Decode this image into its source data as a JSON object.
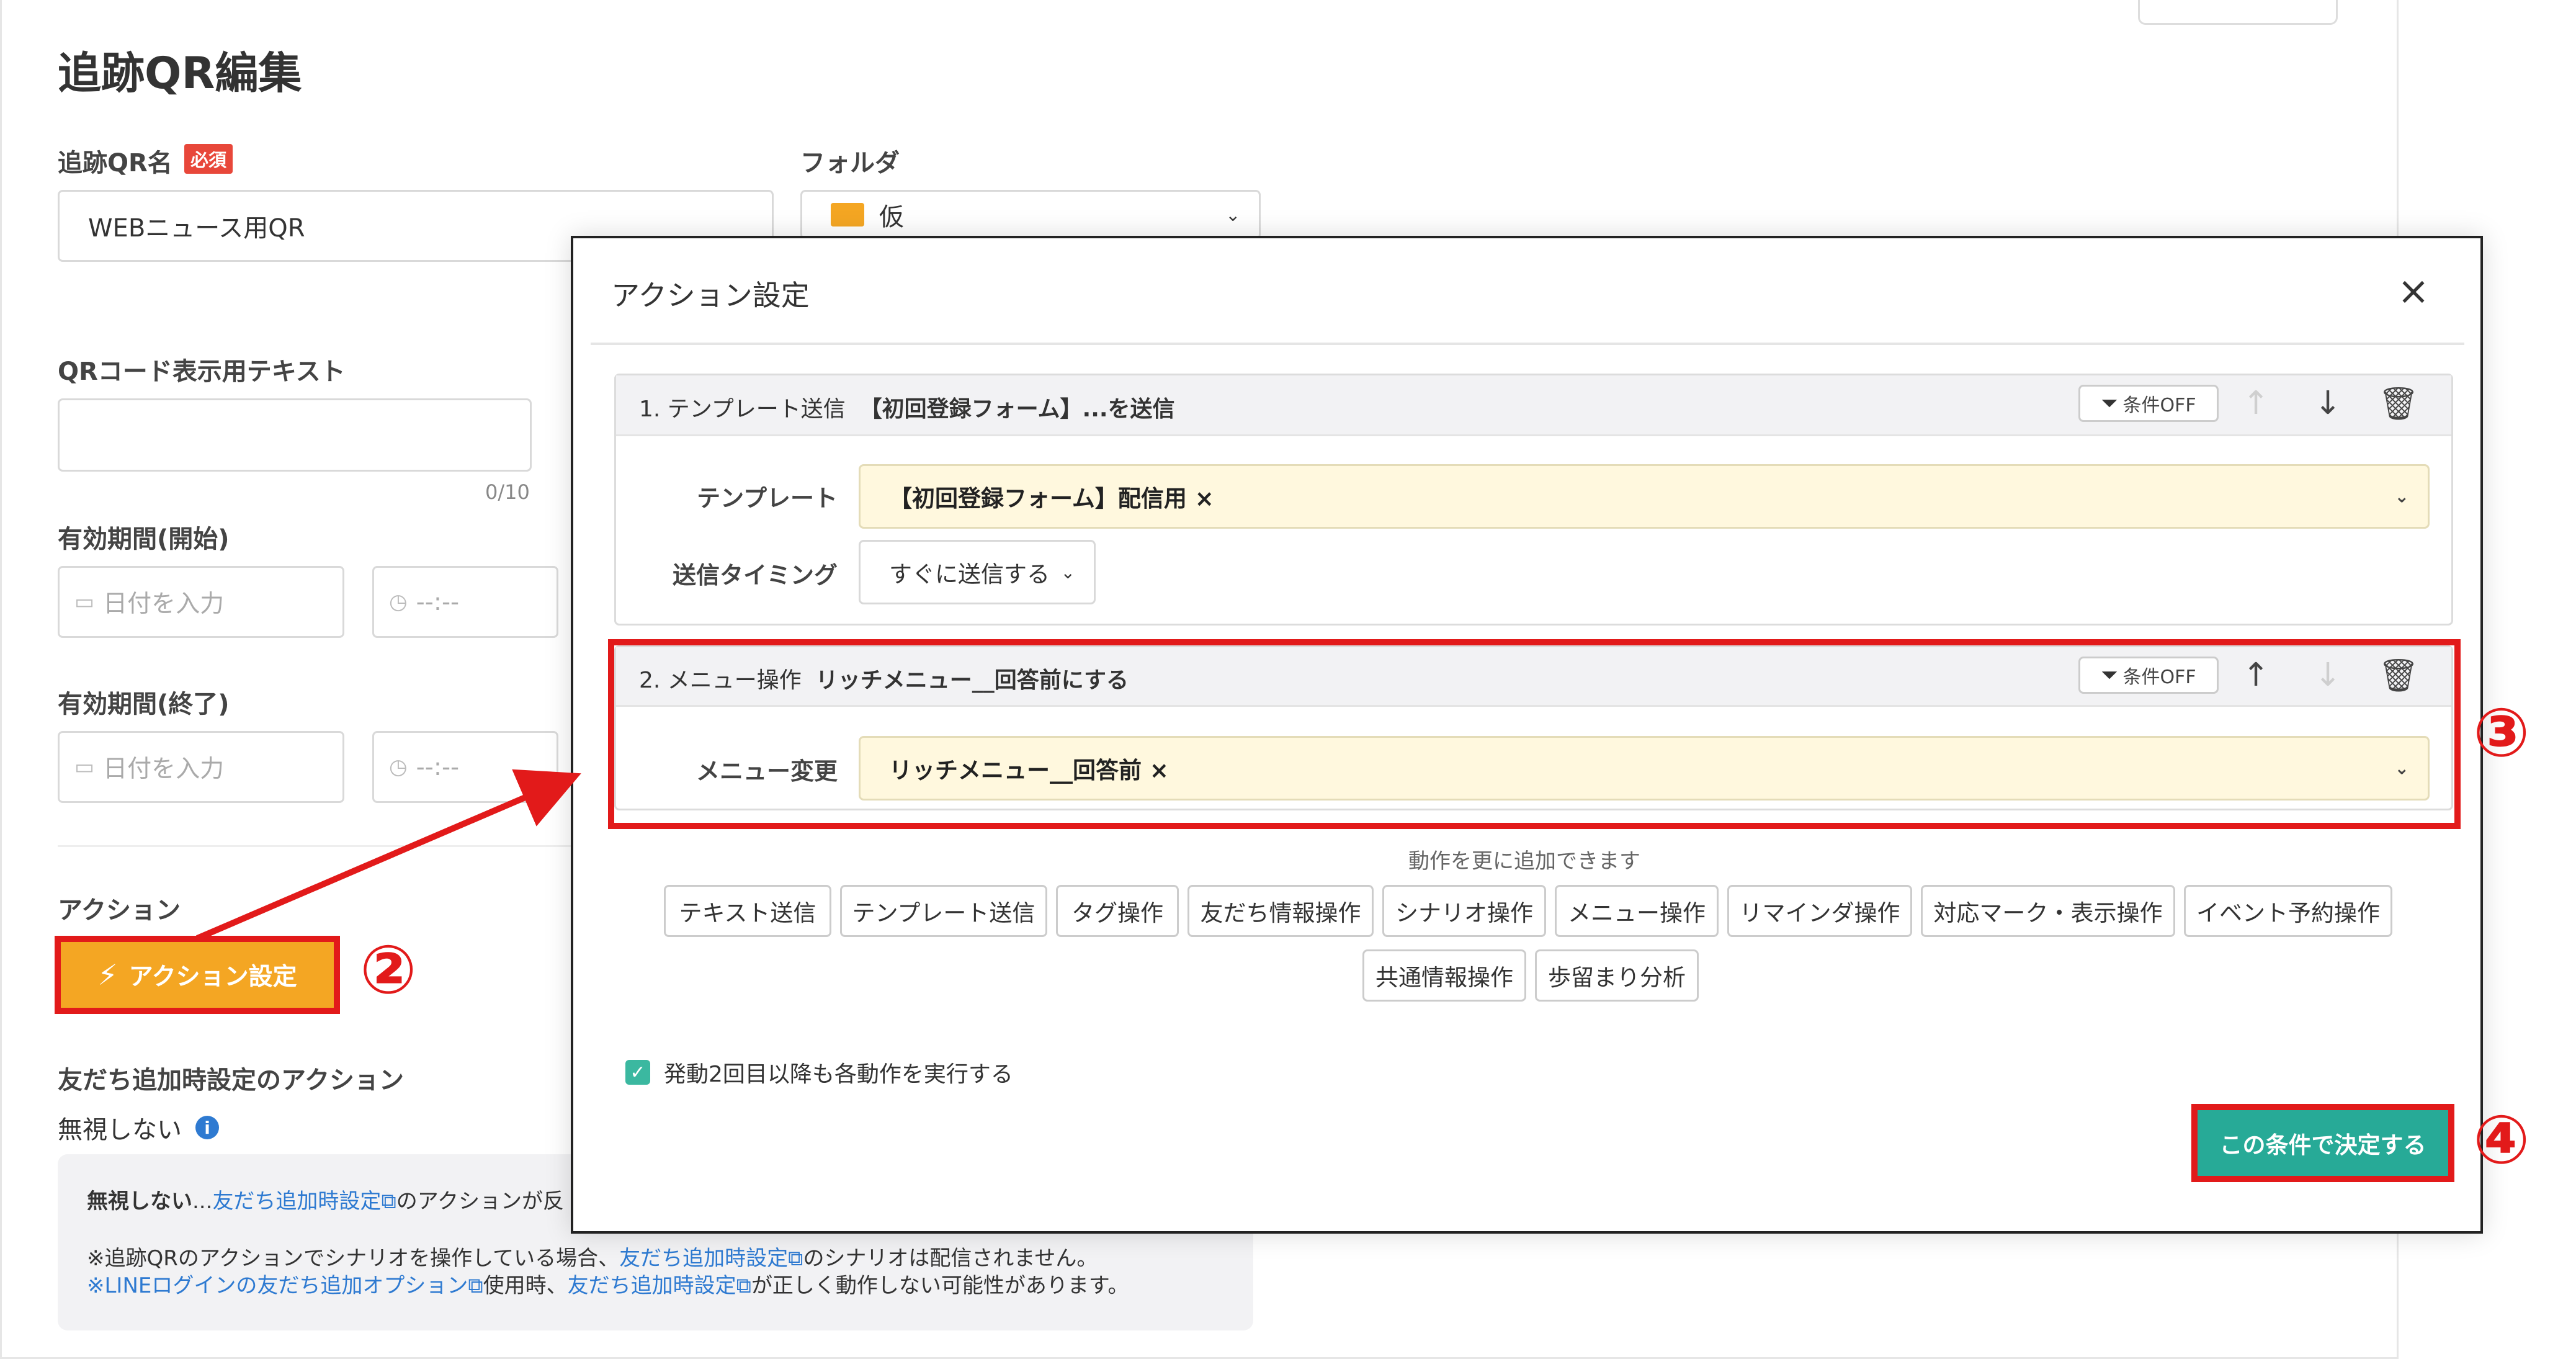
{
  "page": {
    "title": "追跡QR編集",
    "qr_name": {
      "label": "追跡QR名",
      "required_badge": "必須",
      "value": "WEBニュース用QR"
    },
    "folder": {
      "label": "フォルダ",
      "value": "仮"
    },
    "qr_text": {
      "label": "QRコード表示用テキスト",
      "value": "",
      "counter": "0/10"
    },
    "valid_start": {
      "label": "有効期間(開始)",
      "date_placeholder": "日付を入力",
      "time_placeholder": "--:--"
    },
    "valid_end": {
      "label": "有効期間(終了)",
      "date_placeholder": "日付を入力",
      "time_placeholder": "--:--"
    },
    "action": {
      "label": "アクション",
      "button_label": "アクション設定"
    },
    "friend_add": {
      "label": "友だち追加時設定のアクション",
      "value": "無視しない",
      "info_icon": "i",
      "note": {
        "line1_prefix": "無視しない",
        "line1_ellipsis": "...",
        "line1_link": "友だち追加時設定",
        "line1_suffix": "のアクションが反",
        "line2_prefix": "※追跡QRのアクションでシナリオを操作している場合、",
        "line2_link": "友だち追加時設定",
        "line2_suffix": "のシナリオは配信されません。",
        "line3_link1": "※LINEログインの友だち追加オプション",
        "line3_mid": "使用時、",
        "line3_link2": "友だち追加時設定",
        "line3_suffix": "が正しく動作しない可能性があります。"
      }
    }
  },
  "modal": {
    "title": "アクション設定",
    "close_glyph": "×",
    "actions": [
      {
        "title_prefix": "1. テンプレート送信",
        "title_bold": "【初回登録フォーム】...を送信",
        "cond_label": "条件OFF",
        "template_label": "テンプレート",
        "template_value": "【初回登録フォーム】配信用 ×",
        "timing_label": "送信タイミング",
        "timing_value": "すぐに送信する"
      },
      {
        "title_prefix": "2. メニュー操作",
        "title_bold": "リッチメニュー__回答前にする",
        "cond_label": "条件OFF",
        "menu_label": "メニュー変更",
        "menu_value": "リッチメニュー__回答前 ×"
      }
    ],
    "add_hint": "動作を更に追加できます",
    "add_buttons_row1": [
      "テキスト送信",
      "テンプレート送信",
      "タグ操作",
      "友だち情報操作",
      "シナリオ操作",
      "メニュー操作",
      "リマインダ操作",
      "対応マーク・表示操作",
      "イベント予約操作"
    ],
    "add_buttons_row2": [
      "共通情報操作",
      "歩留まり分析"
    ],
    "repeat_checkbox_label": "発動2回目以降も各動作を実行する",
    "repeat_checked": true,
    "decide_button": "この条件で決定する"
  },
  "annotations": {
    "step2": "②",
    "step3": "③",
    "step4": "④"
  },
  "colors": {
    "accent_orange": "#f4a623",
    "annotation_red": "#e21a1a",
    "teal": "#27aa97",
    "link_blue": "#2e7ad1"
  }
}
